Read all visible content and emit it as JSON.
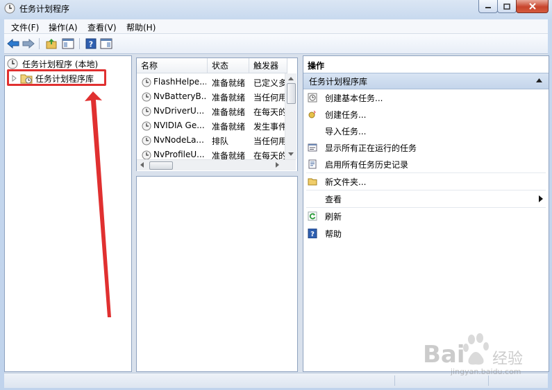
{
  "window": {
    "title": "任务计划程序"
  },
  "menubar": {
    "items": [
      "文件(F)",
      "操作(A)",
      "查看(V)",
      "帮助(H)"
    ]
  },
  "tree": {
    "root_label": "任务计划程序 (本地)",
    "child_label": "任务计划程序库"
  },
  "task_list": {
    "columns": [
      "名称",
      "状态",
      "触发器"
    ],
    "rows": [
      {
        "name": "FlashHelpe...",
        "status": "准备就绪",
        "trigger": "已定义多"
      },
      {
        "name": "NvBatteryB...",
        "status": "准备就绪",
        "trigger": "当任何用"
      },
      {
        "name": "NvDriverU...",
        "status": "准备就绪",
        "trigger": "在每天的"
      },
      {
        "name": "NVIDIA Ge...",
        "status": "准备就绪",
        "trigger": "发生事件"
      },
      {
        "name": "NvNodeLa...",
        "status": "排队",
        "trigger": "当任何用"
      },
      {
        "name": "NvProfileU...",
        "status": "准备就绪",
        "trigger": "在每天的"
      }
    ]
  },
  "actions": {
    "header": "操作",
    "section": "任务计划程序库",
    "items": [
      {
        "label": "创建基本任务...",
        "icon": "create-basic-task-icon"
      },
      {
        "label": "创建任务...",
        "icon": "create-task-icon"
      },
      {
        "label": "导入任务...",
        "icon": ""
      },
      {
        "label": "显示所有正在运行的任务",
        "icon": "running-tasks-icon"
      },
      {
        "label": "启用所有任务历史记录",
        "icon": "history-icon"
      },
      {
        "label": "新文件夹...",
        "icon": "folder-icon"
      },
      {
        "label": "查看",
        "icon": ""
      },
      {
        "label": "刷新",
        "icon": "refresh-icon"
      },
      {
        "label": "帮助",
        "icon": "help-icon"
      }
    ]
  },
  "watermark": {
    "brand": "Bai",
    "brand_suffix": "经验",
    "url": "jingyan.baidu.com"
  },
  "colors": {
    "annotation_red": "#e03030",
    "selection_blue": "#c4d5eb"
  }
}
